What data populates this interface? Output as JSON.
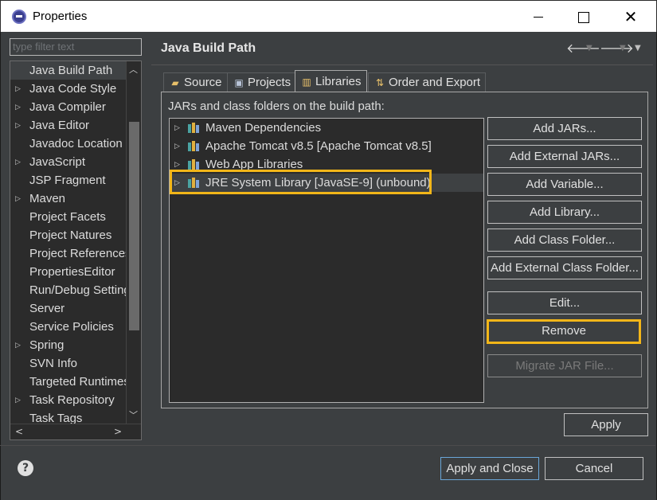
{
  "window": {
    "title": "Properties"
  },
  "filter": {
    "placeholder": "type filter text"
  },
  "tree": {
    "items": [
      {
        "label": "Java Build Path",
        "expandable": false,
        "selected": true
      },
      {
        "label": "Java Code Style",
        "expandable": true
      },
      {
        "label": "Java Compiler",
        "expandable": true
      },
      {
        "label": "Java Editor",
        "expandable": true
      },
      {
        "label": "Javadoc Location",
        "expandable": false
      },
      {
        "label": "JavaScript",
        "expandable": true
      },
      {
        "label": "JSP Fragment",
        "expandable": false
      },
      {
        "label": "Maven",
        "expandable": true
      },
      {
        "label": "Project Facets",
        "expandable": false
      },
      {
        "label": "Project Natures",
        "expandable": false
      },
      {
        "label": "Project References",
        "expandable": false
      },
      {
        "label": "PropertiesEditor",
        "expandable": false
      },
      {
        "label": "Run/Debug Settings",
        "expandable": false
      },
      {
        "label": "Server",
        "expandable": false
      },
      {
        "label": "Service Policies",
        "expandable": false
      },
      {
        "label": "Spring",
        "expandable": true
      },
      {
        "label": "SVN Info",
        "expandable": false
      },
      {
        "label": "Targeted Runtimes",
        "expandable": false
      },
      {
        "label": "Task Repository",
        "expandable": true
      },
      {
        "label": "Task Tags",
        "expandable": false
      }
    ]
  },
  "page": {
    "title": "Java Build Path"
  },
  "tabs": [
    {
      "label": "Source",
      "icon": "source-folder-icon"
    },
    {
      "label": "Projects",
      "icon": "projects-icon"
    },
    {
      "label": "Libraries",
      "icon": "libraries-icon",
      "active": true
    },
    {
      "label": "Order and Export",
      "icon": "order-export-icon"
    }
  ],
  "libraries": {
    "label": "JARs and class folders on the build path:",
    "items": [
      {
        "label": "Maven Dependencies"
      },
      {
        "label": "Apache Tomcat v8.5 [Apache Tomcat v8.5]"
      },
      {
        "label": "Web App Libraries"
      },
      {
        "label": "JRE System Library [JavaSE-9] (unbound)",
        "selected": true
      }
    ]
  },
  "buttons": {
    "add_jars": "Add JARs...",
    "add_external_jars": "Add External JARs...",
    "add_variable": "Add Variable...",
    "add_library": "Add Library...",
    "add_class_folder": "Add Class Folder...",
    "add_external_class_folder": "Add External Class Folder...",
    "edit": "Edit...",
    "remove": "Remove",
    "migrate_jar": "Migrate JAR File...",
    "apply": "Apply",
    "apply_and_close": "Apply and Close",
    "cancel": "Cancel"
  },
  "colors": {
    "highlight": "#f2b619",
    "background": "#3c3f41",
    "list_bg": "#2b2b2b"
  }
}
